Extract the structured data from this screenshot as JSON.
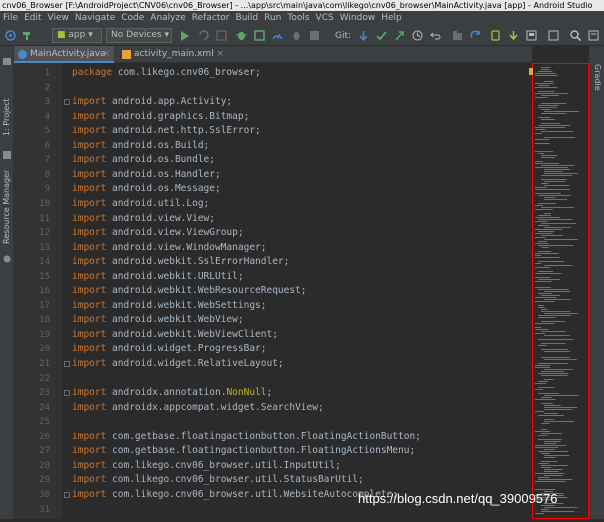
{
  "window": {
    "title": "cnv06_Browser [F:\\AndroidProject\\CNV06\\cnv06_Browser] - ...\\app\\src\\main\\java\\com\\likego\\cnv06_browser\\MainActivity.java [app] - Android Studio"
  },
  "menu": [
    "File",
    "Edit",
    "View",
    "Navigate",
    "Code",
    "Analyze",
    "Refactor",
    "Build",
    "Run",
    "Tools",
    "VCS",
    "Window",
    "Help"
  ],
  "toolbar": {
    "module": "app",
    "device": "No Devices",
    "git_label": "Git:"
  },
  "tabs": [
    {
      "label": "MainActivity.java",
      "active": true
    },
    {
      "label": "activity_main.xml",
      "active": false
    }
  ],
  "left_tools": {
    "project": "1: Project",
    "resource_manager": "Resource Manager"
  },
  "right_tools": {
    "gradle": "Gradle"
  },
  "code_lines": [
    {
      "n": "1",
      "parts": [
        [
          "kw",
          "package "
        ],
        [
          "tx",
          "com.likego.cnv06_browser;"
        ]
      ]
    },
    {
      "n": "2",
      "parts": []
    },
    {
      "n": "3",
      "parts": [
        [
          "kw",
          "import "
        ],
        [
          "tx",
          "android.app.Activity;"
        ]
      ]
    },
    {
      "n": "4",
      "parts": [
        [
          "kw",
          "import "
        ],
        [
          "tx",
          "android.graphics.Bitmap;"
        ]
      ]
    },
    {
      "n": "5",
      "parts": [
        [
          "kw",
          "import "
        ],
        [
          "tx",
          "android.net.http.SslError;"
        ]
      ]
    },
    {
      "n": "6",
      "parts": [
        [
          "kw",
          "import "
        ],
        [
          "tx",
          "android.os.Build;"
        ]
      ]
    },
    {
      "n": "7",
      "parts": [
        [
          "kw",
          "import "
        ],
        [
          "tx",
          "android.os.Bundle;"
        ]
      ]
    },
    {
      "n": "8",
      "parts": [
        [
          "kw",
          "import "
        ],
        [
          "tx",
          "android.os.Handler;"
        ]
      ]
    },
    {
      "n": "9",
      "parts": [
        [
          "kw",
          "import "
        ],
        [
          "tx",
          "android.os.Message;"
        ]
      ]
    },
    {
      "n": "10",
      "parts": [
        [
          "kw",
          "import "
        ],
        [
          "tx",
          "android.util.Log;"
        ]
      ]
    },
    {
      "n": "11",
      "parts": [
        [
          "kw",
          "import "
        ],
        [
          "tx",
          "android.view.View;"
        ]
      ]
    },
    {
      "n": "12",
      "parts": [
        [
          "kw",
          "import "
        ],
        [
          "tx",
          "android.view.ViewGroup;"
        ]
      ]
    },
    {
      "n": "13",
      "parts": [
        [
          "kw",
          "import "
        ],
        [
          "tx",
          "android.view.WindowManager;"
        ]
      ]
    },
    {
      "n": "14",
      "parts": [
        [
          "kw",
          "import "
        ],
        [
          "tx",
          "android.webkit.SslErrorHandler;"
        ]
      ]
    },
    {
      "n": "15",
      "parts": [
        [
          "kw",
          "import "
        ],
        [
          "tx",
          "android.webkit.URLUtil;"
        ]
      ]
    },
    {
      "n": "16",
      "parts": [
        [
          "kw",
          "import "
        ],
        [
          "tx",
          "android.webkit.WebResourceRequest;"
        ]
      ]
    },
    {
      "n": "17",
      "parts": [
        [
          "kw",
          "import "
        ],
        [
          "tx",
          "android.webkit.WebSettings;"
        ]
      ]
    },
    {
      "n": "18",
      "parts": [
        [
          "kw",
          "import "
        ],
        [
          "tx",
          "android.webkit.WebView;"
        ]
      ]
    },
    {
      "n": "19",
      "parts": [
        [
          "kw",
          "import "
        ],
        [
          "tx",
          "android.webkit.WebViewClient;"
        ]
      ]
    },
    {
      "n": "20",
      "parts": [
        [
          "kw",
          "import "
        ],
        [
          "tx",
          "android.widget.ProgressBar;"
        ]
      ]
    },
    {
      "n": "21",
      "parts": [
        [
          "kw",
          "import "
        ],
        [
          "tx",
          "android.widget.RelativeLayout;"
        ]
      ]
    },
    {
      "n": "22",
      "parts": []
    },
    {
      "n": "23",
      "parts": [
        [
          "kw",
          "import "
        ],
        [
          "tx",
          "androidx.annotation."
        ],
        [
          "ann",
          "NonNull"
        ],
        [
          "tx",
          ";"
        ]
      ]
    },
    {
      "n": "24",
      "parts": [
        [
          "kw",
          "import "
        ],
        [
          "tx",
          "androidx.appcompat.widget.SearchView;"
        ]
      ]
    },
    {
      "n": "25",
      "parts": []
    },
    {
      "n": "26",
      "parts": [
        [
          "kw",
          "import "
        ],
        [
          "tx",
          "com.getbase.floatingactionbutton.FloatingActionButton;"
        ]
      ]
    },
    {
      "n": "27",
      "parts": [
        [
          "kw",
          "import "
        ],
        [
          "tx",
          "com.getbase.floatingactionbutton.FloatingActionsMenu;"
        ]
      ]
    },
    {
      "n": "28",
      "parts": [
        [
          "kw",
          "import "
        ],
        [
          "tx",
          "com.likego.cnv06_browser.util.InputUtil;"
        ]
      ]
    },
    {
      "n": "29",
      "parts": [
        [
          "kw",
          "import "
        ],
        [
          "tx",
          "com.likego.cnv06_browser.util.StatusBarUtil;"
        ]
      ]
    },
    {
      "n": "30",
      "parts": [
        [
          "kw",
          "import "
        ],
        [
          "tx",
          "com.likego.cnv06_browser.util.WebsiteAutocomplete;"
        ]
      ]
    },
    {
      "n": "31",
      "parts": []
    }
  ],
  "watermark": "https://blog.csdn.net/qq_39009576",
  "colors": {
    "keyword": "#cc7832",
    "text": "#a9b7c6",
    "annotation": "#bbb529",
    "highlight_border": "#ff0000"
  }
}
